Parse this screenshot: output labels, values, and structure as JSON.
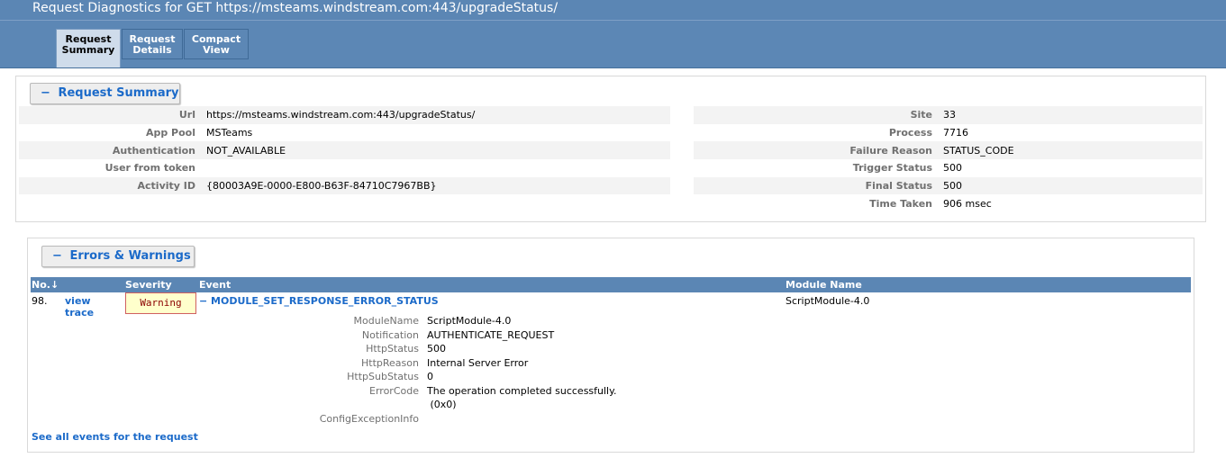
{
  "header": {
    "title": "Request Diagnostics for GET https://msteams.windstream.com:443/upgradeStatus/"
  },
  "tabs": [
    {
      "line1": "Request",
      "line2": "Summary",
      "active": true
    },
    {
      "line1": "Request",
      "line2": "Details",
      "active": false
    },
    {
      "line1": "Compact",
      "line2": "View",
      "active": false
    }
  ],
  "summary": {
    "section_label": "Request Summary",
    "toggle_glyph": "−",
    "left": [
      {
        "key": "Url",
        "value": "https://msteams.windstream.com:443/upgradeStatus/"
      },
      {
        "key": "App Pool",
        "value": "MSTeams"
      },
      {
        "key": "Authentication",
        "value": "NOT_AVAILABLE"
      },
      {
        "key": "User from token",
        "value": ""
      },
      {
        "key": "Activity ID",
        "value": "{80003A9E-0000-E800-B63F-84710C7967BB}"
      }
    ],
    "right": [
      {
        "key": "Site",
        "value": "33"
      },
      {
        "key": "Process",
        "value": "7716"
      },
      {
        "key": "Failure Reason",
        "value": "STATUS_CODE"
      },
      {
        "key": "Trigger Status",
        "value": "500"
      },
      {
        "key": "Final Status",
        "value": "500"
      },
      {
        "key": "Time Taken",
        "value": "906 msec"
      }
    ]
  },
  "errors": {
    "section_label": "Errors & Warnings",
    "toggle_glyph": "−",
    "columns": {
      "no": "No.↓",
      "severity": "Severity",
      "event": "Event",
      "module": "Module Name"
    },
    "row": {
      "no": "98.",
      "view_trace_line1": "view",
      "view_trace_line2": "trace",
      "severity": "Warning",
      "event": "− MODULE_SET_RESPONSE_ERROR_STATUS",
      "module": "ScriptModule-4.0",
      "details": [
        {
          "key": "ModuleName",
          "value": "ScriptModule-4.0"
        },
        {
          "key": "Notification",
          "value": "AUTHENTICATE_REQUEST"
        },
        {
          "key": "HttpStatus",
          "value": "500"
        },
        {
          "key": "HttpReason",
          "value": "Internal Server Error"
        },
        {
          "key": "HttpSubStatus",
          "value": "0"
        },
        {
          "key": "ErrorCode",
          "value": "The operation completed successfully."
        },
        {
          "key": "",
          "value": " (0x0)"
        },
        {
          "key": "ConfigExceptionInfo",
          "value": ""
        }
      ]
    },
    "see_all_link": "See all events for the request"
  },
  "colors": {
    "header_bg": "#5b86b4",
    "link": "#1b6ac9",
    "warning_text": "#8b0000",
    "warning_bg": "#ffffcc"
  }
}
